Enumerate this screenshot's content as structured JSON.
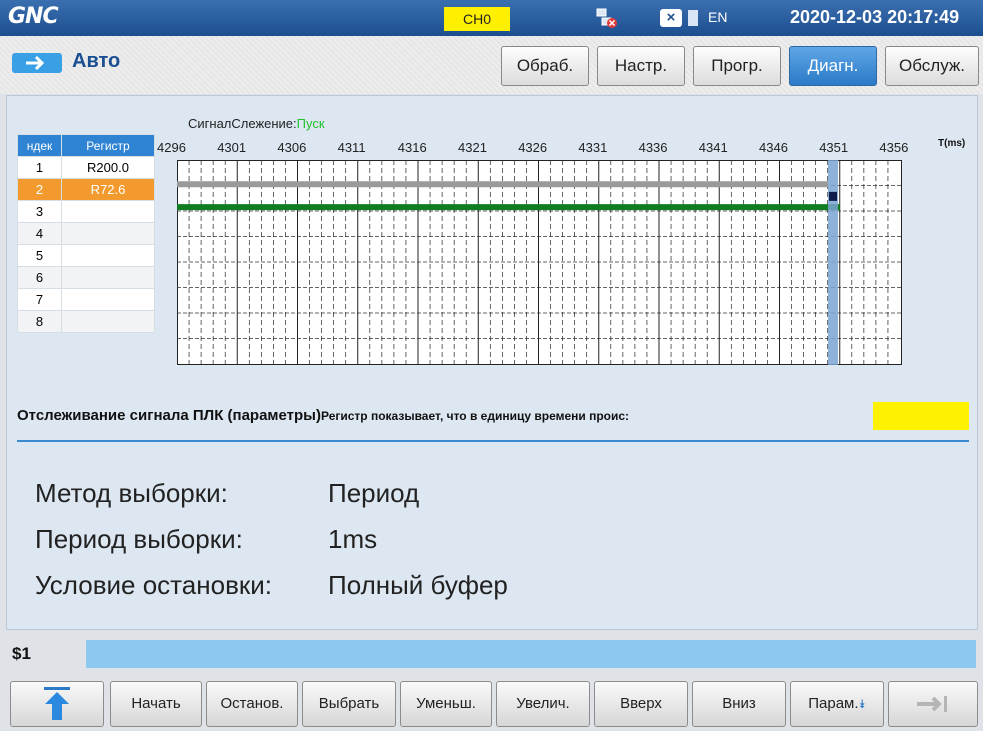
{
  "titlebar": {
    "logo": "GNC",
    "channel": "CH0",
    "language": "EN",
    "datetime": "2020-12-03 20:17:49"
  },
  "mode": {
    "label": "Авто"
  },
  "tabs": [
    {
      "label": "Обраб.",
      "active": false
    },
    {
      "label": "Настр.",
      "active": false
    },
    {
      "label": "Прогр.",
      "active": false
    },
    {
      "label": "Диагн.",
      "active": true
    },
    {
      "label": "Обслуж.",
      "active": false
    }
  ],
  "register_table": {
    "col_index": "ндек",
    "col_register": "Регистр",
    "rows": [
      {
        "index": "1",
        "register": "R200.0"
      },
      {
        "index": "2",
        "register": "R72.6"
      },
      {
        "index": "3",
        "register": ""
      },
      {
        "index": "4",
        "register": ""
      },
      {
        "index": "5",
        "register": ""
      },
      {
        "index": "6",
        "register": ""
      },
      {
        "index": "7",
        "register": ""
      },
      {
        "index": "8",
        "register": ""
      }
    ]
  },
  "trace": {
    "label": "СигналСлежение:",
    "state": "Пуск",
    "unit": "T(ms)",
    "ticks": [
      "4296",
      "4301",
      "4306",
      "4311",
      "4316",
      "4321",
      "4326",
      "4331",
      "4336",
      "4341",
      "4346",
      "4351",
      "4356"
    ]
  },
  "status": {
    "title": "Отслеживание сигнала ПЛК (параметры)",
    "message": "Регистр показывает, что в единицу времени проис:"
  },
  "params": {
    "method_label": "Метод выборки:",
    "method_value": "Период",
    "period_label": "Период выборки:",
    "period_value": "1ms",
    "stop_label": "Условие остановки:",
    "stop_value": "Полный буфер"
  },
  "command": {
    "label": "$1"
  },
  "buttons": {
    "start": "Начать",
    "stop": "Останов.",
    "select": "Выбрать",
    "decrease": "Уменьш.",
    "increase": "Увелич.",
    "up": "Вверх",
    "down": "Вниз",
    "params": "Парам."
  },
  "colors": {
    "accent": "#2e83d2",
    "selected_row": "#f29a2e",
    "signal_gray": "#9a9a9a",
    "signal_green": "#0f7d20",
    "cursor": "#7aa3d2"
  }
}
